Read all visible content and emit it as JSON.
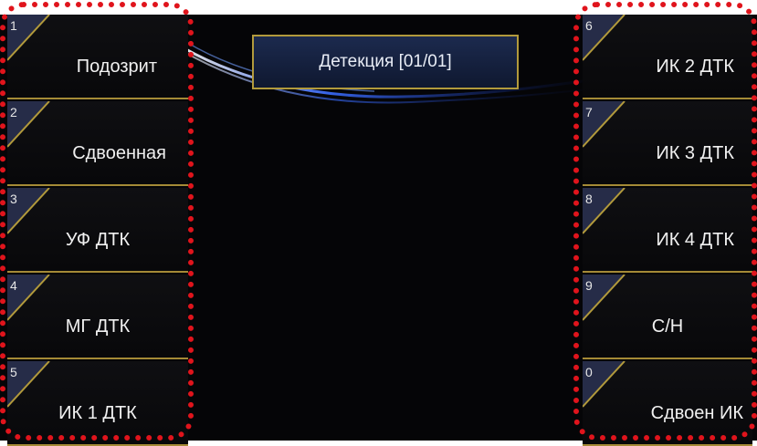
{
  "header": {
    "title": "Детекция [01/01]"
  },
  "left_buttons": [
    {
      "num": "1",
      "label": "Подозрит"
    },
    {
      "num": "2",
      "label": "Сдвоенная"
    },
    {
      "num": "3",
      "label": "УФ ДТК"
    },
    {
      "num": "4",
      "label": "МГ ДТК"
    },
    {
      "num": "5",
      "label": "ИК 1 ДТК"
    }
  ],
  "right_buttons": [
    {
      "num": "6",
      "label": "ИК 2 ДТК"
    },
    {
      "num": "7",
      "label": "ИК 3 ДТК"
    },
    {
      "num": "8",
      "label": "ИК 4 ДТК"
    },
    {
      "num": "9",
      "label": "С/Н"
    },
    {
      "num": "0",
      "label": "Сдвоен ИК"
    }
  ],
  "colors": {
    "background": "#050507",
    "accent_gold": "#a48a36",
    "highlight_red": "#e0141c",
    "title_fill": "#1c2a4e"
  }
}
